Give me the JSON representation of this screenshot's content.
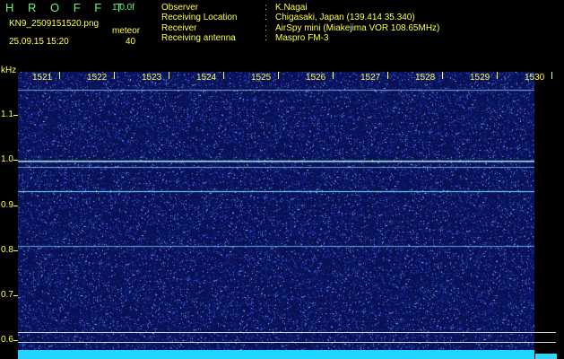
{
  "header": {
    "brand": "H R O F F T",
    "version": "1.0.0f",
    "filename": "KN9_2509151520.png",
    "mode": "meteor",
    "datetime": "25.09.15 15:20",
    "count": "40",
    "fields": [
      {
        "label": "Observer",
        "value": "K.Nagai"
      },
      {
        "label": "Receiving Location",
        "value": "Chigasaki, Japan (139.414 35.340)"
      },
      {
        "label": "Receiver",
        "value": "AirSpy mini (Miakejima VOR 108.65MHz)"
      },
      {
        "label": "Receiving antenna",
        "value": "Maspro FM-3"
      }
    ]
  },
  "spectrogram": {
    "y_unit": "kHz",
    "y_ticks": [
      "1.1",
      "1.0",
      "0.9",
      "0.8",
      "0.7",
      "0.6"
    ],
    "x_ticks": [
      "1521",
      "1522",
      "1523",
      "1524",
      "1525",
      "1526",
      "1527",
      "1528",
      "1529",
      "1530"
    ],
    "colors": {
      "background": "#091055",
      "noise_bright": "#7fb0ff",
      "axis": "#ffff4a",
      "bottom_bar": "#1fd4ff"
    }
  }
}
